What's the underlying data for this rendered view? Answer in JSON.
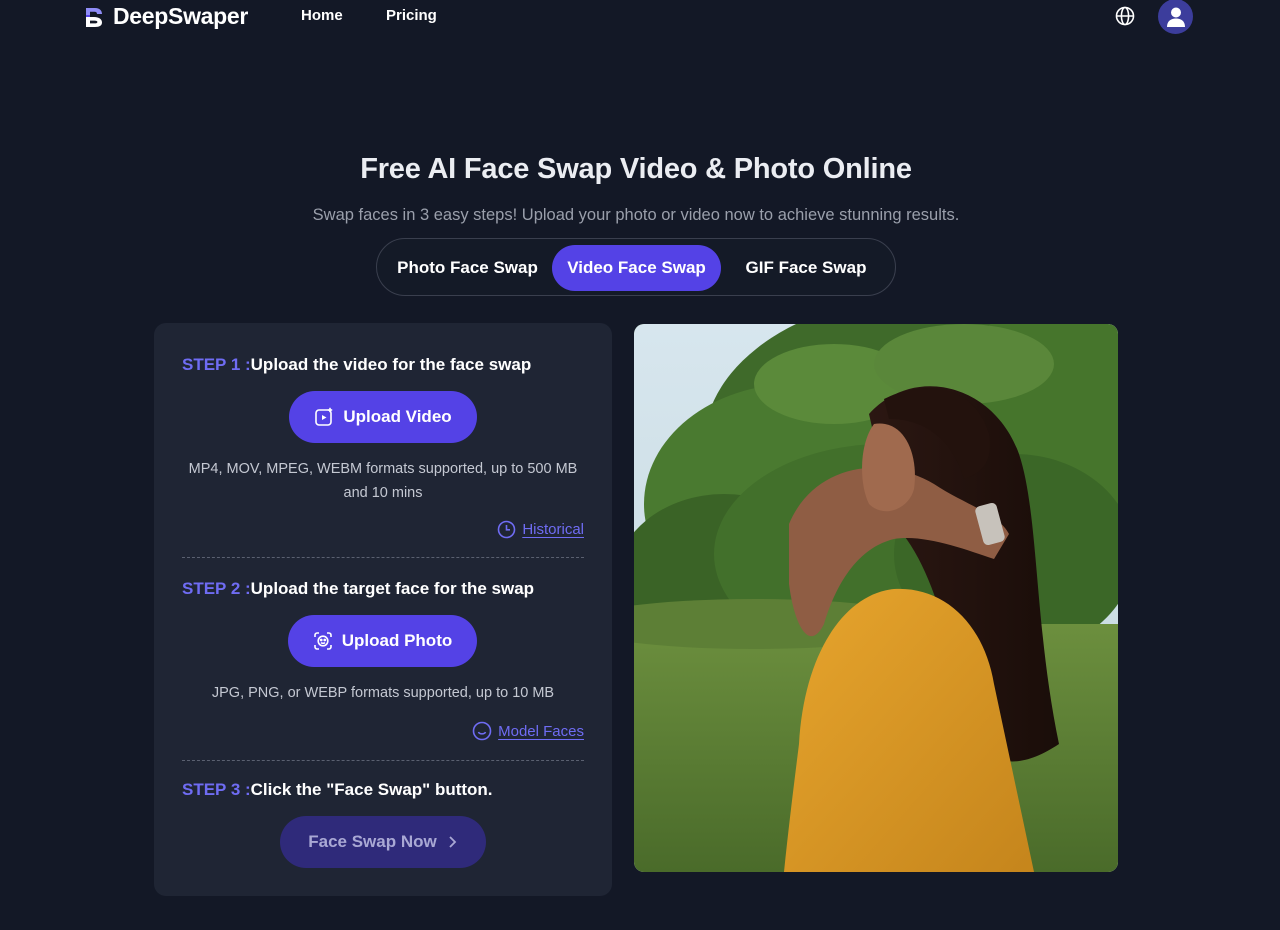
{
  "brand": {
    "name": "DeepSwaper",
    "logo_icon": "ds-logo-icon"
  },
  "nav": {
    "home_label": "Home",
    "pricing_label": "Pricing",
    "language_icon": "globe-icon",
    "account_icon": "user-icon"
  },
  "hero": {
    "title": "Free AI Face Swap Video & Photo Online",
    "subtitle": "Swap faces in 3 easy steps! Upload your photo or video now to achieve stunning results."
  },
  "tabs": [
    {
      "label": "Photo Face Swap",
      "active": false
    },
    {
      "label": "Video Face Swap",
      "active": true
    },
    {
      "label": "GIF Face Swap",
      "active": false
    }
  ],
  "steps": {
    "step1": {
      "label": "STEP 1 :",
      "text": "Upload the video for the face swap",
      "button_label": "Upload Video",
      "button_icon": "video-upload-icon",
      "hint": "MP4, MOV, MPEG, WEBM formats supported, up to 500 MB and 10 mins",
      "link_label": "Historical",
      "link_icon": "clock-icon"
    },
    "step2": {
      "label": "STEP 2 :",
      "text": "Upload the target face for the swap",
      "button_label": "Upload Photo",
      "button_icon": "face-scan-icon",
      "hint": "JPG, PNG, or WEBP formats supported, up to 10 MB",
      "link_label": "Model Faces",
      "link_icon": "smile-icon"
    },
    "step3": {
      "label": "STEP 3 :",
      "text": "Click the \"Face Swap\" button.",
      "button_label": "Face Swap Now",
      "button_icon": "chevron-right-icon"
    }
  },
  "colors": {
    "background": "#131826",
    "card": "#1f2534",
    "accent": "#5442e6",
    "accent_text": "#6f6cf3",
    "disabled_button": "#2f2a7a"
  }
}
